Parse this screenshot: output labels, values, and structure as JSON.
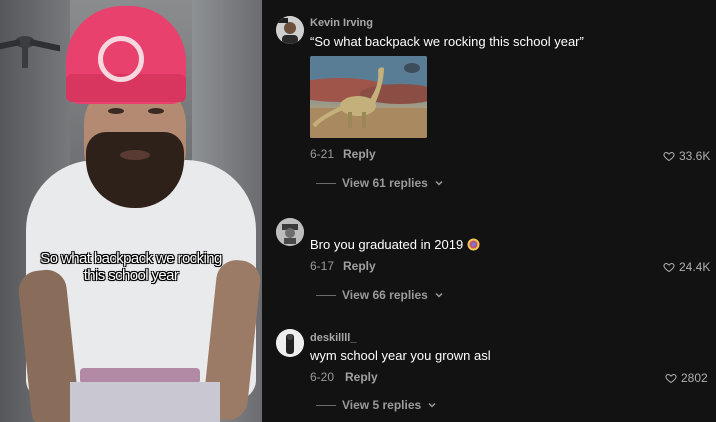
{
  "video": {
    "caption_lines": [
      "So what backpack we rocking",
      "this school year"
    ]
  },
  "comments": [
    {
      "username": "Kevin Irving",
      "text": "“So what backpack we rocking this school year”",
      "has_image": true,
      "image_icon": "dinosaur-painting",
      "date": "6-21",
      "reply_label": "Reply",
      "likes": "33.6K",
      "view_replies": "View 61 replies"
    },
    {
      "username": "",
      "text": "Bro you graduated in 2019",
      "emoji_icon": "crying-laughing-emoji",
      "date": "6-17",
      "reply_label": "Reply",
      "likes": "24.4K",
      "view_replies": "View 66 replies"
    },
    {
      "username": "deskillll_",
      "text": "wym school year you grown asl",
      "date": "6-20",
      "reply_label": "Reply",
      "likes": "2802",
      "view_replies": "View 5 replies"
    }
  ],
  "colors": {
    "background": "#121212",
    "hat": "#e8416e",
    "shirt": "#e9eaec"
  }
}
